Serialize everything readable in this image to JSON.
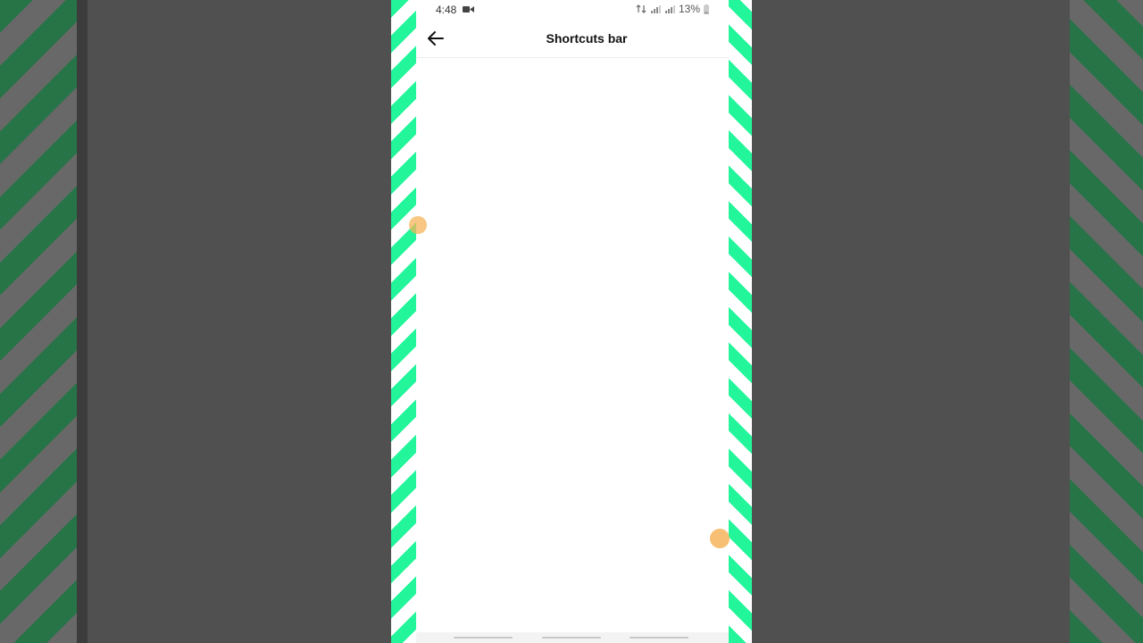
{
  "status_bar": {
    "time": "4:48",
    "battery": "13%",
    "icons": [
      "screen-record-icon",
      "data-icon",
      "signal-icon",
      "signal-icon",
      "battery-icon"
    ]
  },
  "app_bar": {
    "title": "Shortcuts bar",
    "back_icon": "arrow-left-icon"
  },
  "colors": {
    "frame_stripe": "#22f59a",
    "touch_indicator": "#f5b45a",
    "backdrop": "#505050"
  }
}
